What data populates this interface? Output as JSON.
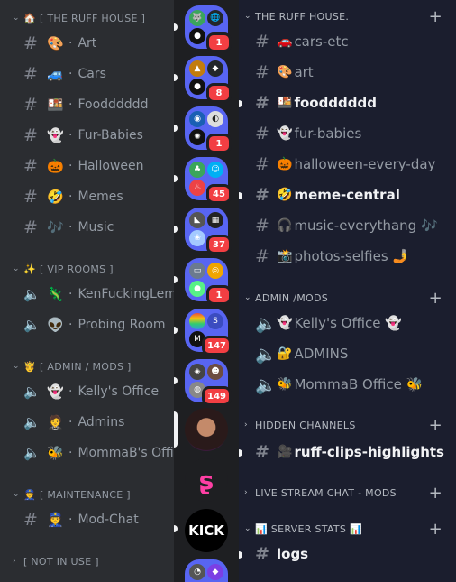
{
  "left": {
    "categories": [
      {
        "emoji": "🏠",
        "label": "[ THE RUFF HOUSE ]"
      },
      {
        "emoji": "✨",
        "label": "[ VIP ROOMS ]"
      },
      {
        "emoji": "🤴",
        "label": "[ ADMIN / MODS ]"
      },
      {
        "emoji": "👮",
        "label": "[ MAINTENANCE ]"
      },
      {
        "emoji": "",
        "label": "[ NOT IN USE ]"
      }
    ],
    "channels": [
      {
        "type": "text",
        "emoji": "🎨",
        "label": "Art"
      },
      {
        "type": "text",
        "emoji": "🚙",
        "label": "Cars"
      },
      {
        "type": "text",
        "emoji": "🍱",
        "label": "Foodddddd"
      },
      {
        "type": "text",
        "emoji": "👻",
        "label": "Fur-Babies"
      },
      {
        "type": "text",
        "emoji": "🎃",
        "label": "Halloween"
      },
      {
        "type": "text",
        "emoji": "🤣",
        "label": "Memes"
      },
      {
        "type": "text",
        "emoji": "🎶",
        "label": "Music"
      },
      {
        "type": "voice",
        "emoji": "🦎",
        "label": "KenFuckingLem"
      },
      {
        "type": "voice",
        "emoji": "👽",
        "label": "Probing Room"
      },
      {
        "type": "voice",
        "emoji": "👻",
        "label": "Kelly's Office"
      },
      {
        "type": "voice",
        "emoji": "🤵",
        "label": "Admins"
      },
      {
        "type": "voice",
        "emoji": "🐝",
        "label": "MommaB's Offi"
      },
      {
        "type": "text",
        "emoji": "👮",
        "label": "Mod-Chat"
      }
    ]
  },
  "rail": {
    "badges": [
      "1",
      "8",
      "1",
      "45",
      "37",
      "1",
      "147",
      "149"
    ],
    "kick_label": "KICK"
  },
  "right": {
    "categories": [
      {
        "label": "THE RUFF HOUSE."
      },
      {
        "label": "ADMIN /MODS"
      },
      {
        "label": "HIDDEN CHANNELS"
      },
      {
        "label": "LIVE STREAM CHAT - MODS"
      },
      {
        "label": "📊 SERVER STATS 📊"
      }
    ],
    "channels": [
      {
        "emoji": "🚗",
        "label": "cars-etc"
      },
      {
        "emoji": "🎨",
        "label": "art"
      },
      {
        "emoji": "🍱",
        "label": "foodddddd"
      },
      {
        "emoji": "👻",
        "label": "fur-babies"
      },
      {
        "emoji": "🎃",
        "label": "halloween-every-day"
      },
      {
        "emoji": "🤣",
        "label": "meme-central"
      },
      {
        "emoji": "🎧",
        "label": "music-everythang 🎶"
      },
      {
        "emoji": "📸",
        "label": "photos-selfies 🤳"
      },
      {
        "emoji": "👻",
        "label": "Kelly's Office 👻"
      },
      {
        "emoji": "🔐",
        "label": "ADMINS"
      },
      {
        "emoji": "🐝",
        "label": "MommaB Office 🐝"
      },
      {
        "emoji": "🎥",
        "label": "ruff-clips-highlights"
      },
      {
        "emoji": "",
        "label": "logs"
      }
    ]
  },
  "colors": {
    "accent": "#5865f2",
    "badge": "#f23f43",
    "muted": "#949ba4",
    "bright": "#f2f3f5"
  }
}
